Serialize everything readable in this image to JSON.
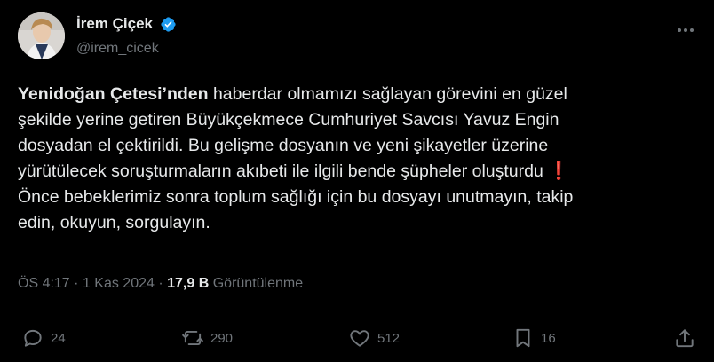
{
  "user": {
    "display_name": "İrem Çiçek",
    "handle": "@irem_cicek",
    "verified": true,
    "verified_color": "#1d9bf0"
  },
  "tweet": {
    "lines": [
      {
        "bold": "Yenidoğan Çetesi’nden",
        "text": " haberdar olmamızı sağlayan görevini en güzel"
      },
      {
        "text": "şekilde yerine getiren Büyükçekmece Cumhuriyet Savcısı Yavuz Engin"
      },
      {
        "text": "dosyadan el çektirildi. Bu gelişme dosyanın ve yeni şikayetler üzerine"
      },
      {
        "text": "yürütülecek soruşturmaların akıbeti ile ilgili bende şüpheler oluşturdu",
        "emoji": "❗"
      },
      {
        "text": "Önce bebeklerimiz sonra toplum sağlığı için bu dosyayı unutmayın, takip"
      },
      {
        "text": "edin, okuyun, sorgulayın."
      }
    ],
    "time": "ÖS 4:17",
    "separator": "·",
    "date": "1 Kas 2024",
    "views_count": "17,9 B",
    "views_label": "Görüntülenme"
  },
  "actions": {
    "reply_count": "24",
    "retweet_count": "290",
    "like_count": "512",
    "bookmark_count": "16"
  },
  "icons": {
    "more": "more-horizontal-icon",
    "reply": "reply-icon",
    "retweet": "retweet-icon",
    "like": "heart-icon",
    "bookmark": "bookmark-icon",
    "share": "share-icon"
  }
}
